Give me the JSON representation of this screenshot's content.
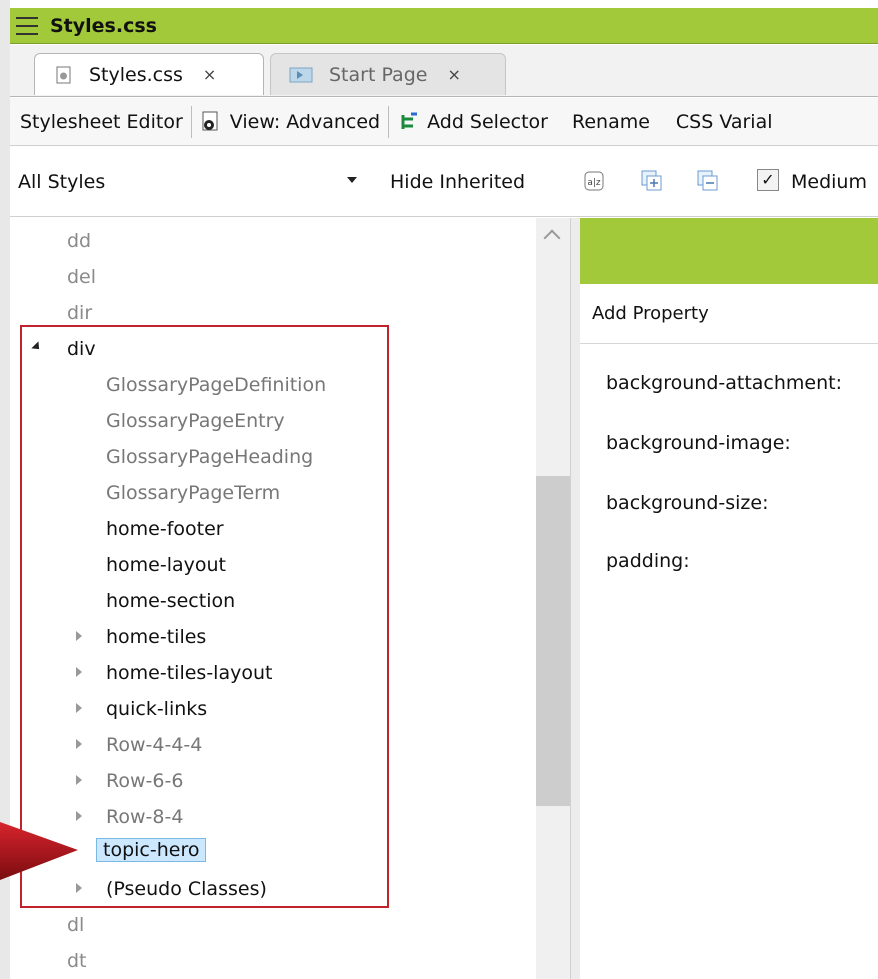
{
  "window": {
    "title": "Styles.css"
  },
  "tabs": [
    {
      "label": "Styles.css",
      "close": "×"
    },
    {
      "label": "Start Page",
      "close": "×"
    }
  ],
  "toolbar": {
    "stylesheet_editor": "Stylesheet Editor",
    "view": "View: Advanced",
    "add_selector": "Add Selector",
    "rename": "Rename",
    "css_variables": "CSS Varial"
  },
  "filter": {
    "select_value": "All Styles",
    "hide_inherited": "Hide Inherited",
    "medium_label": "Medium",
    "medium_checked": "✓"
  },
  "tree": {
    "above": [
      "dd",
      "del",
      "dir"
    ],
    "div_label": "div",
    "children": [
      {
        "label": "GlossaryPageDefinition",
        "inherited": true
      },
      {
        "label": "GlossaryPageEntry",
        "inherited": true
      },
      {
        "label": "GlossaryPageHeading",
        "inherited": true
      },
      {
        "label": "GlossaryPageTerm",
        "inherited": true
      },
      {
        "label": "home-footer"
      },
      {
        "label": "home-layout"
      },
      {
        "label": "home-section"
      },
      {
        "label": "home-tiles",
        "expandable": true
      },
      {
        "label": "home-tiles-layout",
        "expandable": true
      },
      {
        "label": "quick-links",
        "expandable": true
      },
      {
        "label": "Row-4-4-4",
        "expandable": true,
        "inherited": true
      },
      {
        "label": "Row-6-6",
        "expandable": true,
        "inherited": true
      },
      {
        "label": "Row-8-4",
        "expandable": true,
        "inherited": true
      },
      {
        "label": "topic-hero",
        "selected": true
      },
      {
        "label": "(Pseudo Classes)",
        "expandable": true
      }
    ],
    "below": [
      "dl",
      "dt"
    ]
  },
  "properties": {
    "add_property": "Add Property",
    "items": [
      "background-attachment:",
      "background-image:",
      "background-size:",
      "padding:"
    ]
  },
  "colors": {
    "accent": "#a2c93a",
    "highlight_border": "#c0232c",
    "selection": "#cce8ff"
  }
}
